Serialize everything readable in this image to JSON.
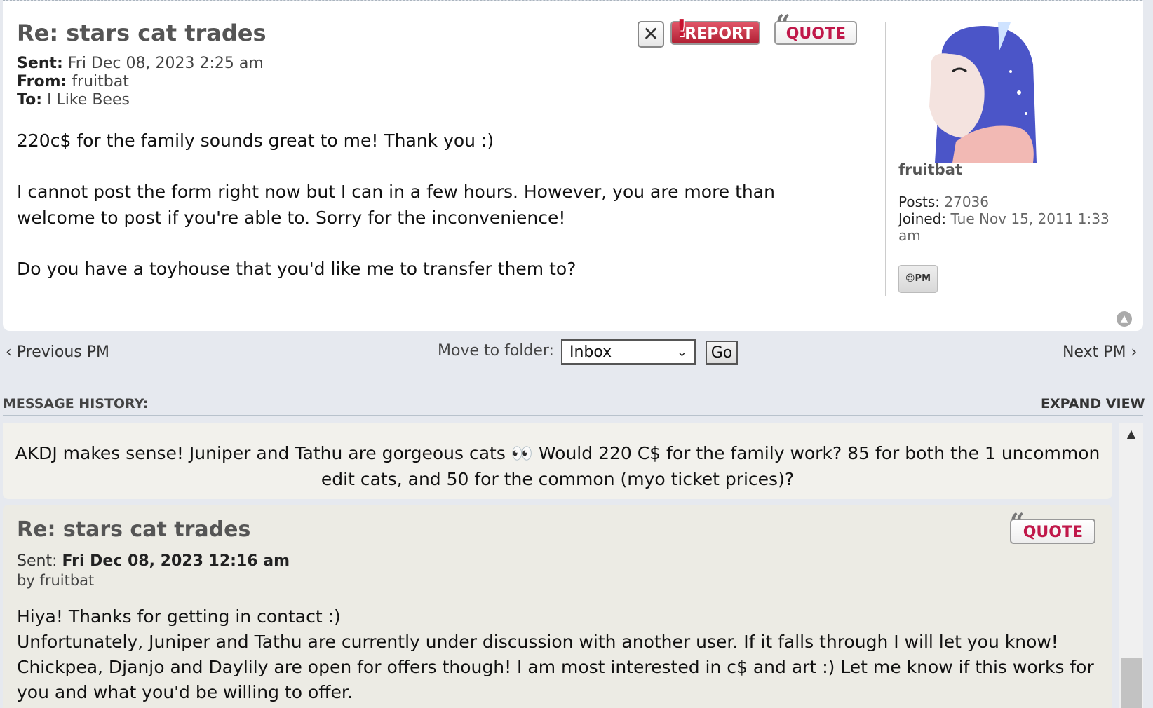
{
  "message": {
    "title": "Re: stars cat trades",
    "sent_label": "Sent:",
    "sent_value": "Fri Dec 08, 2023 2:25 am",
    "from_label": "From:",
    "from_value": "fruitbat",
    "to_label": "To:",
    "to_value": "I Like Bees",
    "body": [
      "220c$ for the family sounds great to me! Thank you :)",
      "I cannot post the form right now but I can in a few hours. However, you are more than welcome to post if you're able to. Sorry for the inconvenience!",
      "Do you have a toyhouse that you'd like me to transfer them to?"
    ],
    "buttons": {
      "delete": "✕",
      "report": "REPORT",
      "quote": "QUOTE"
    }
  },
  "profile": {
    "username": "fruitbat",
    "posts_label": "Posts:",
    "posts_value": "27036",
    "joined_label": "Joined:",
    "joined_value": "Tue Nov 15, 2011 1:33 am",
    "pm_button": "PM"
  },
  "nav": {
    "previous": "Previous PM",
    "next": "Next PM",
    "move_label": "Move to folder:",
    "folder_selected": "Inbox",
    "go": "Go"
  },
  "history": {
    "label": "MESSAGE HISTORY:",
    "expand": "EXPAND VIEW",
    "messages": [
      {
        "body": "AKDJ makes sense! Juniper and Tathu are gorgeous cats 👀 Would 220 C$ for the family work? 85 for both the 1 uncommon edit cats, and 50 for the common (myo ticket prices)?"
      },
      {
        "title": "Re: stars cat trades",
        "sent_label": "Sent:",
        "sent_value": "Fri Dec 08, 2023 12:16 am",
        "by": "by fruitbat",
        "quote": "QUOTE",
        "body": [
          "Hiya! Thanks for getting in contact :)",
          "Unfortunately, Juniper and Tathu are currently under discussion with another user. If it falls through I will let you know!",
          "Chickpea, Djanjo and Daylily are open for offers though! I am most interested in c$ and art :) Let me know if this works for you and what you'd be willing to offer."
        ]
      }
    ]
  },
  "colors": {
    "page_bg": "#e6e9ef",
    "card_bg": "#ffffff",
    "quote_red": "#c0184a",
    "report_red": "#b01f33"
  }
}
